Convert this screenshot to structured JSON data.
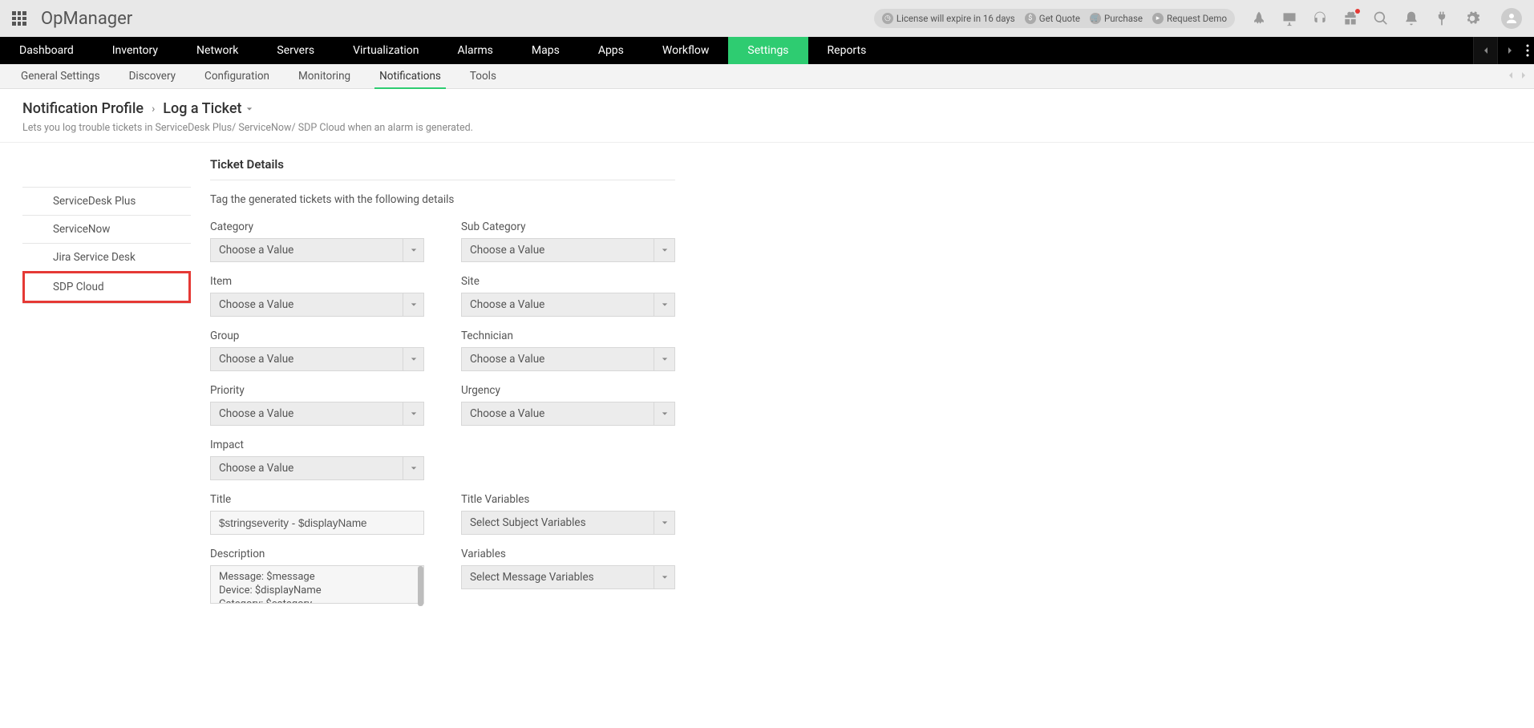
{
  "brand": "OpManager",
  "license_pill": {
    "expire": "License will expire in 16 days",
    "quote": "Get Quote",
    "purchase": "Purchase",
    "demo": "Request Demo"
  },
  "main_nav": [
    "Dashboard",
    "Inventory",
    "Network",
    "Servers",
    "Virtualization",
    "Alarms",
    "Maps",
    "Apps",
    "Workflow",
    "Settings",
    "Reports"
  ],
  "main_nav_active": 9,
  "sub_nav": [
    "General Settings",
    "Discovery",
    "Configuration",
    "Monitoring",
    "Notifications",
    "Tools"
  ],
  "sub_nav_active": 4,
  "breadcrumb": {
    "root": "Notification Profile",
    "leaf": "Log a Ticket"
  },
  "page_desc": "Lets you log trouble tickets in ServiceDesk Plus/ ServiceNow/ SDP Cloud when an alarm is generated.",
  "left_tabs": [
    "ServiceDesk Plus",
    "ServiceNow",
    "Jira Service Desk",
    "SDP Cloud"
  ],
  "left_tab_highlight": 3,
  "section_title": "Ticket Details",
  "section_sub": "Tag the generated tickets with the following details",
  "placeholders": {
    "choose": "Choose a Value",
    "subject_vars": "Select Subject Variables",
    "msg_vars": "Select Message Variables"
  },
  "fields": {
    "category": "Category",
    "subcategory": "Sub Category",
    "item": "Item",
    "site": "Site",
    "group": "Group",
    "technician": "Technician",
    "priority": "Priority",
    "urgency": "Urgency",
    "impact": "Impact",
    "title": "Title",
    "titlevars": "Title Variables",
    "description": "Description",
    "variables": "Variables"
  },
  "values": {
    "title": "$stringseverity - $displayName",
    "description": "Message: $message\nDevice: $displayName\nCategory: $category"
  }
}
